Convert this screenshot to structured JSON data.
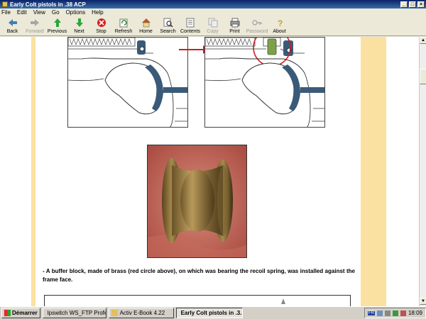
{
  "window": {
    "title": "Early Colt pistols in .38 ACP"
  },
  "menu": [
    "File",
    "Edit",
    "View",
    "Go",
    "Options",
    "Help"
  ],
  "toolbar": [
    {
      "label": "Back",
      "icon": "back-arrow-icon",
      "enabled": true
    },
    {
      "label": "Forward",
      "icon": "forward-arrow-icon",
      "enabled": false
    },
    {
      "label": "Previous",
      "icon": "up-arrow-icon",
      "enabled": true
    },
    {
      "label": "Next",
      "icon": "down-arrow-icon",
      "enabled": true
    },
    {
      "label": "Stop",
      "icon": "stop-icon",
      "enabled": true
    },
    {
      "label": "Refresh",
      "icon": "refresh-icon",
      "enabled": true
    },
    {
      "label": "Home",
      "icon": "home-icon",
      "enabled": true
    },
    {
      "label": "Search",
      "icon": "search-icon",
      "enabled": true
    },
    {
      "label": "Contents",
      "icon": "contents-icon",
      "enabled": true
    },
    {
      "label": "Copy",
      "icon": "copy-icon",
      "enabled": false
    },
    {
      "label": "Print",
      "icon": "print-icon",
      "enabled": true
    },
    {
      "label": "Password",
      "icon": "key-icon",
      "enabled": false
    },
    {
      "label": "About",
      "icon": "help-icon",
      "enabled": true
    }
  ],
  "content": {
    "caption": "- A buffer block, made of brass (red circle above), on which was bearing the recoil spring, was installed against the frame face."
  },
  "taskbar": {
    "start_label": "Démarrer",
    "tasks": [
      {
        "label": "Ipswitch WS_FTP Profes...",
        "active": false
      },
      {
        "label": "Activ E-Book 4.22",
        "active": false
      },
      {
        "label": "Early Colt pistols in .3...",
        "active": true
      }
    ],
    "lang": "FR",
    "clock": "18:09"
  },
  "colors": {
    "titlebar": "#0a246a",
    "page_band": "#fbe1a1",
    "annotation_red": "#cc1f1f",
    "part_blue": "#3a5a78"
  }
}
